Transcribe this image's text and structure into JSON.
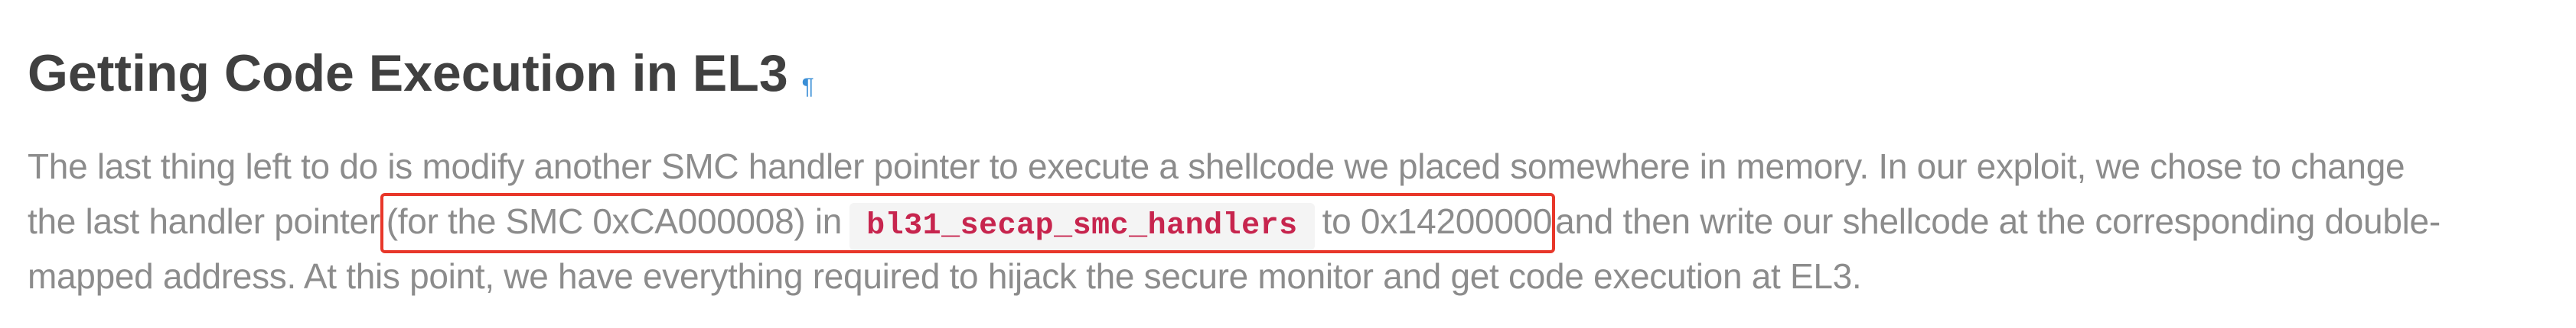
{
  "heading": {
    "title": "Getting Code Execution in EL3",
    "anchor_icon": "¶"
  },
  "paragraph": {
    "line1": "The last thing left to do is modify another SMC handler pointer to execute a shellcode we placed somewhere in memory. In our exploit, we chose to change",
    "line2_before": "the last handler pointer",
    "highlight_part1": "(for the SMC 0xCA000008) in",
    "code": "bl31_secap_smc_handlers",
    "highlight_part2": "to 0x14200000",
    "line2_after": "and then write our shellcode at the corresponding double-",
    "line3": "mapped address. At this point, we have everything required to hijack the secure monitor and get code execution at EL3."
  },
  "colors": {
    "heading": "#404040",
    "body_text": "#8c8c8c",
    "highlight_border": "#e8372a",
    "code_text": "#c7254e",
    "code_background": "#f4f4f4",
    "anchor": "#3b8fd6"
  }
}
